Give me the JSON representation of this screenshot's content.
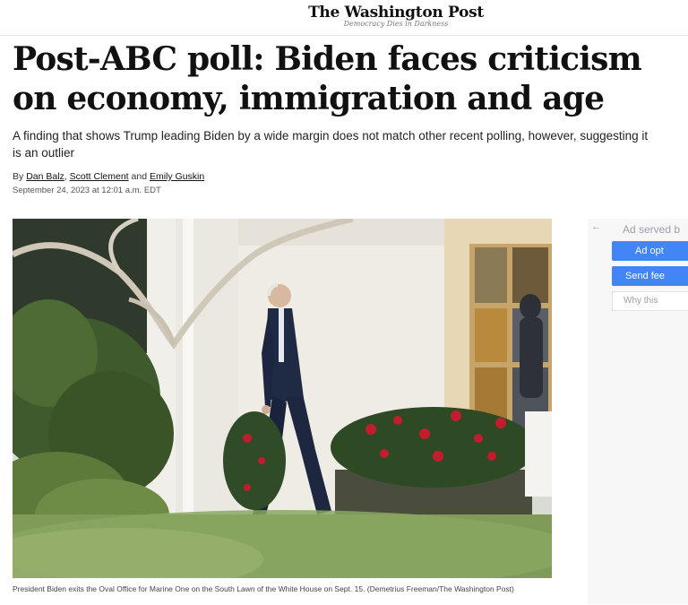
{
  "masthead": {
    "logo": "The Washington Post",
    "tagline": "Democracy Dies in Darkness"
  },
  "article": {
    "headline": "Post-ABC poll: Biden faces criticism on economy, immigration and age",
    "dek": "A finding that shows Trump leading Biden by a wide margin does not match other recent polling, however, suggesting it is an outlier",
    "byline_prefix": "By",
    "authors": [
      "Dan Balz",
      "Scott Clement",
      "Emily Guskin"
    ],
    "byline_sep_comma": ",",
    "byline_and": "and",
    "dateline": "September 24, 2023 at 12:01 a.m. EDT",
    "caption": "President Biden exits the Oval Office for Marine One on the South Lawn of the White House on Sept. 15. (Demetrius Freeman/The Washington Post)"
  },
  "ad": {
    "served_by": "Ad served b",
    "options_label": "Ad opt",
    "feedback_label": "Send fee",
    "why_label": "Why this",
    "back_arrow": "←",
    "button_color": "#4285f4"
  }
}
